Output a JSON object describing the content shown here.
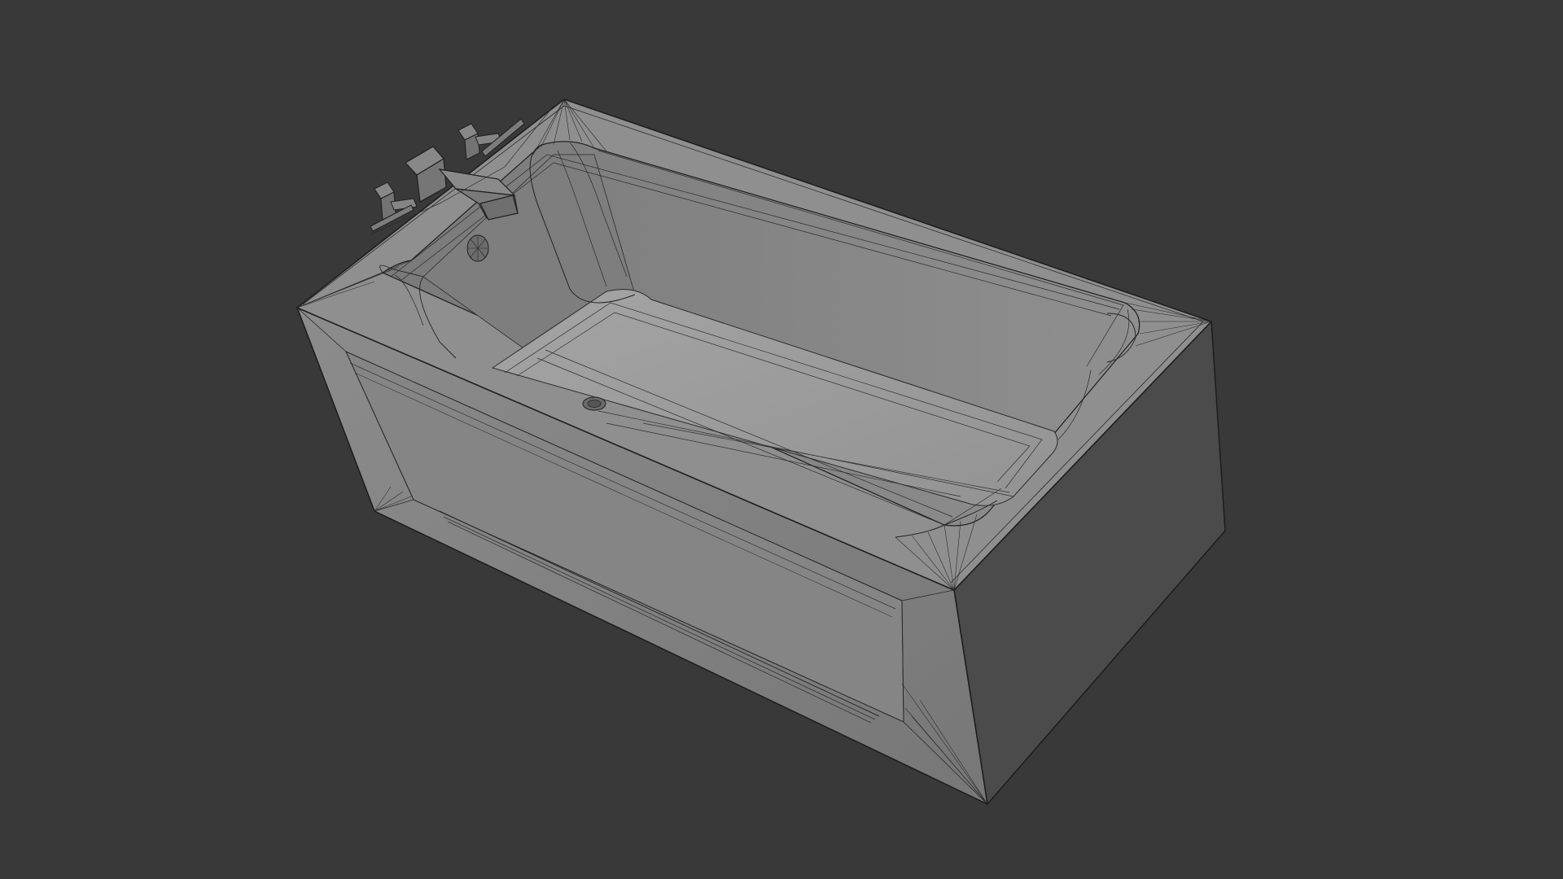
{
  "scene": {
    "object": "bathtub-wireframe-render",
    "colors": {
      "background": "#393939",
      "rim": "#8e8e8e",
      "inner_wall": "#858585",
      "basin_floor": "#9c9c9c",
      "front_panel": "#828282",
      "side_panel": "#4a4a4a",
      "edge": "#1c1c1c",
      "faucet": "#7a7a7a"
    }
  }
}
